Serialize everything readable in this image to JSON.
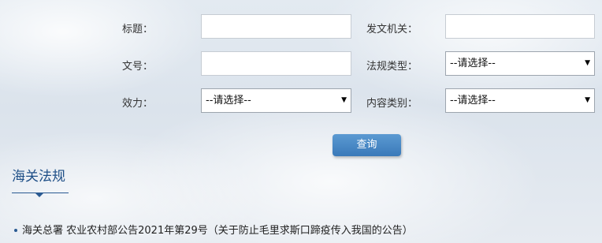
{
  "form": {
    "title_label": "标题：",
    "issuer_label": "发文机关：",
    "doc_no_label": "文号：",
    "reg_type_label": "法规类型：",
    "reg_type_value": "--请选择--",
    "effect_label": "效力：",
    "effect_value": "--请选择--",
    "content_type_label": "内容类别：",
    "content_type_value": "--请选择--",
    "title_value": "",
    "issuer_value": "",
    "doc_no_value": "",
    "search_button": "查询"
  },
  "section": {
    "title": "海关法规"
  },
  "list": {
    "items": [
      {
        "text": "海关总署 农业农村部公告2021年第29号（关于防止毛里求斯口蹄疫传入我国的公告）"
      }
    ]
  }
}
